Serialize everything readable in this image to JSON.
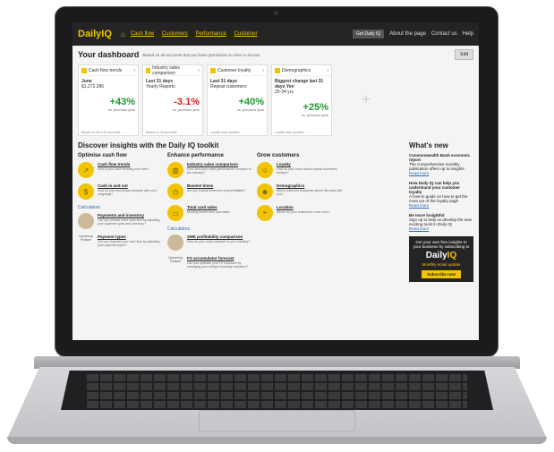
{
  "app": {
    "logo_prefix": "Daily",
    "logo_suffix": "IQ",
    "nav": [
      "Cash flow",
      "Customers",
      "Performance",
      "Customer"
    ],
    "user_chip": "Get Daily IQ",
    "tools": [
      "About the page",
      "Contact us",
      "Help"
    ]
  },
  "dashboard": {
    "title": "Your dashboard",
    "subtitle": "Based on all accounts that you have permission to view or access",
    "edit_label": "Edit",
    "cards": [
      {
        "head": "Cash flow trends",
        "period": "June",
        "value_line": "$1,272,286",
        "change": "+43%",
        "sign": "pos",
        "compare": "vs. previous year",
        "foot": "Based on 45 of 45 accounts"
      },
      {
        "head": "Industry sales comparison",
        "period": "Last 31 days",
        "value_line": "Yearly   Reports",
        "change": "-3.1%",
        "sign": "neg",
        "compare": "vs. previous year",
        "foot": "Based on 45 accounts"
      },
      {
        "head": "Customer loyalty",
        "period": "Last 31 days",
        "value_line": "Repeat customers",
        "change": "+40%",
        "sign": "pos",
        "compare": "vs. previous year",
        "foot": "Loyalty data updated"
      },
      {
        "head": "Demographics",
        "period": "Biggest change last 31 days Yen",
        "value_line": "25-34 yrs",
        "change": "+25%",
        "sign": "pos",
        "compare": "vs. previous year",
        "foot": "Loyalty data updated"
      }
    ],
    "add_symbol": "+"
  },
  "insights": {
    "title": "Discover insights with the Daily IQ toolkit",
    "columns": [
      {
        "title": "Optimise cash flow",
        "items": [
          {
            "t": "Cash flow trends",
            "d": "How is your cash trending over time?"
          },
          {
            "t": "Cash in and out",
            "d": "How do your incomings compare with your outgoings?"
          }
        ],
        "sub": "Calculators",
        "items2": [
          {
            "t": "Payments and inventory",
            "d": "Can you release extra cash flow by adjusting your payment cycle and inventory?"
          },
          {
            "t": "Payment types",
            "d": "Can you improve your cash flow by adjusting your payment types?",
            "badge": "Upcoming Feature"
          }
        ]
      },
      {
        "title": "Enhance performance",
        "items": [
          {
            "t": "Industry sales comparison",
            "d": "How does your sales performance compare to the industry?"
          },
          {
            "t": "Busiest times",
            "d": "Are you busiest times the most profitable?"
          },
          {
            "t": "Total card sales",
            "d": "Monthly trends from card sales"
          }
        ],
        "sub": "Calculators",
        "items2": [
          {
            "t": "SME profitability comparison",
            "d": "How do your costs compare to your industry?"
          },
          {
            "t": "FX accumulator forecast",
            "d": "Can you optimise your FX exposure by managing your foreign exchange exposure?",
            "badge": "Upcoming Feature"
          }
        ]
      },
      {
        "title": "Grow customers",
        "items": [
          {
            "t": "Loyalty",
            "d": "How do your most valued repeat customers behave?"
          },
          {
            "t": "Demographics",
            "d": "Which customer segments spend the most with you?"
          },
          {
            "t": "Location",
            "d": "Where do your customers come from?"
          }
        ]
      }
    ]
  },
  "whats_new": {
    "title": "What's new",
    "items": [
      {
        "title": "Commonwealth Bank economic report",
        "body": "The comprehensive monthly publication offers up to insights",
        "more": "Read more"
      },
      {
        "title": "How Daily IQ can help you understand your customer loyalty",
        "body": "A how-to guide on how to get the most out of the loyalty page",
        "more": "Read more"
      },
      {
        "title": "Be more insightful",
        "body": "Sign up to help us develop the new exciting tools in Daily IQ",
        "more": "Read more"
      }
    ],
    "promo_text": "Get your own free insights to your business by subscribing to",
    "promo_sub": "Monthly email update",
    "promo_btn": "Subscribe now"
  }
}
